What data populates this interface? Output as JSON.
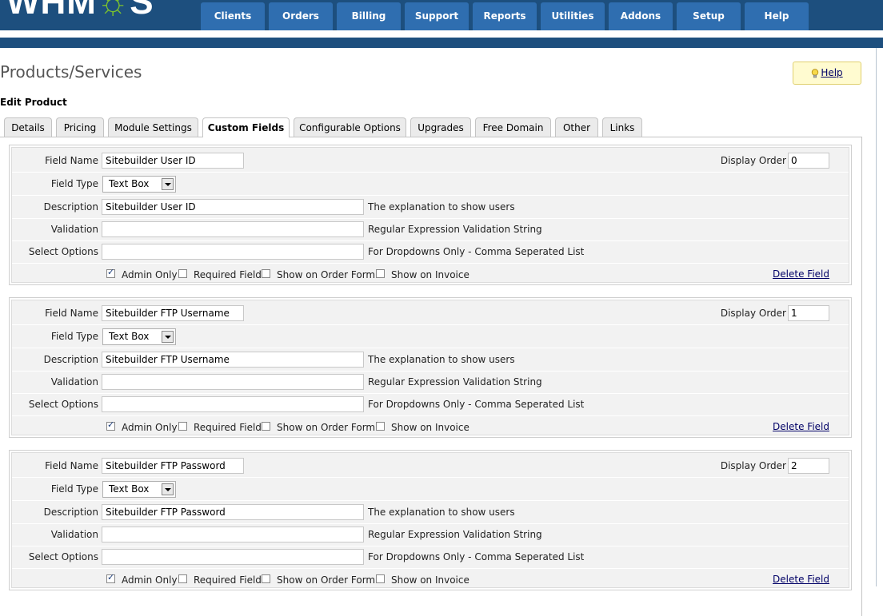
{
  "brand": {
    "logo_text": "WHMCS"
  },
  "nav": {
    "items": [
      {
        "label": "Clients"
      },
      {
        "label": "Orders"
      },
      {
        "label": "Billing"
      },
      {
        "label": "Support"
      },
      {
        "label": "Reports"
      },
      {
        "label": "Utilities"
      },
      {
        "label": "Addons"
      },
      {
        "label": "Setup"
      },
      {
        "label": "Help"
      }
    ]
  },
  "page": {
    "title": "Products/Services",
    "help_label": "Help",
    "section_title": "Edit Product"
  },
  "tabs": [
    {
      "label": "Details"
    },
    {
      "label": "Pricing"
    },
    {
      "label": "Module Settings"
    },
    {
      "label": "Custom Fields",
      "active": true
    },
    {
      "label": "Configurable Options"
    },
    {
      "label": "Upgrades"
    },
    {
      "label": "Free Domain"
    },
    {
      "label": "Other"
    },
    {
      "label": "Links"
    }
  ],
  "labels": {
    "field_name": "Field Name",
    "field_type": "Field Type",
    "description": "Description",
    "validation": "Validation",
    "select_options": "Select Options",
    "display_order": "Display Order",
    "hint_description": "The explanation to show users",
    "hint_validation": "Regular Expression Validation String",
    "hint_select_options": "For Dropdowns Only - Comma Seperated List",
    "admin_only": "Admin Only",
    "required_field": "Required Field",
    "show_on_order_form": "Show on Order Form",
    "show_on_invoice": "Show on Invoice",
    "delete_field": "Delete Field"
  },
  "fields": [
    {
      "field_name": "Sitebuilder User ID",
      "field_type": "Text Box",
      "description": "Sitebuilder User ID",
      "validation": "",
      "select_options": "",
      "display_order": "0",
      "admin_only": true,
      "required": false,
      "show_on_order_form": false,
      "show_on_invoice": false
    },
    {
      "field_name": "Sitebuilder FTP Username",
      "field_type": "Text Box",
      "description": "Sitebuilder FTP Username",
      "validation": "",
      "select_options": "",
      "display_order": "1",
      "admin_only": true,
      "required": false,
      "show_on_order_form": false,
      "show_on_invoice": false
    },
    {
      "field_name": "Sitebuilder FTP Password",
      "field_type": "Text Box",
      "description": "Sitebuilder FTP Password",
      "validation": "",
      "select_options": "",
      "display_order": "2",
      "admin_only": true,
      "required": false,
      "show_on_order_form": false,
      "show_on_invoice": false
    }
  ],
  "colors": {
    "header_bg": "#1d4f7e",
    "nav_button": "#2f6eb0",
    "logo_accent": "#7cc22d",
    "link": "#000066",
    "help_bg": "#fffbd0"
  }
}
